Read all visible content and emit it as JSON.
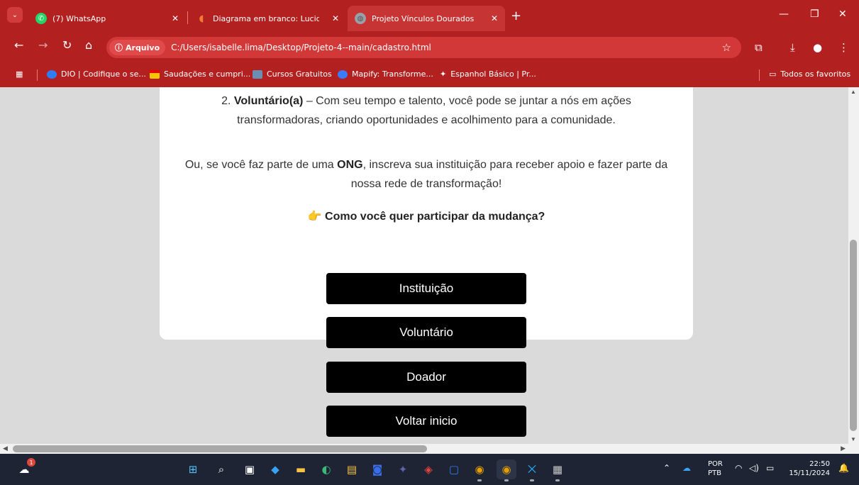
{
  "browser": {
    "tabs": [
      {
        "title": "(7) WhatsApp",
        "icon": "whatsapp-icon",
        "color": "#25d366"
      },
      {
        "title": "Diagrama em branco: Lucidchar",
        "icon": "lucidchart-icon",
        "color": "#f27b35"
      },
      {
        "title": "Projeto Vínculos Dourados",
        "icon": "globe-icon",
        "color": "#9aa0a6",
        "active": true
      }
    ],
    "address": {
      "scheme_label": "Arquivo",
      "url": "C:/Users/isabelle.lima/Desktop/Projeto-4--main/cadastro.html"
    },
    "bookmarks": [
      {
        "label": "DIO | Codifique o se...",
        "icon": "dio-icon",
        "color": "#2f7df6"
      },
      {
        "label": "Saudações e cumpri...",
        "icon": "flag-icon",
        "color": "#f6c700"
      },
      {
        "label": "Cursos Gratuitos",
        "icon": "courses-icon",
        "color": "#6b8fb3"
      },
      {
        "label": "Mapify: Transforme...",
        "icon": "mapify-icon",
        "color": "#3a7bff"
      },
      {
        "label": "Espanhol Básico | Pr...",
        "icon": "spanish-icon",
        "color": "#ffffff"
      }
    ],
    "all_bookmarks_label": "Todos os favoritos"
  },
  "page": {
    "para1": {
      "prefix": "2. ",
      "bold": "Voluntário(a)",
      "line1_rest": " – Com seu tempo e talento, você pode se juntar a nós em ações",
      "line2": "transformadoras, criando oportunidades e acolhimento para a comunidade."
    },
    "para2": {
      "before": "Ou, se você faz parte de uma ",
      "bold": "ONG",
      "line1_rest": ", inscreva sua instituição para receber apoio e fazer parte da",
      "line2": "nossa rede de transformação!"
    },
    "cta": {
      "emoji": "👉",
      "text": "Como você quer participar da mudança?"
    },
    "buttons": [
      "Instituição",
      "Voluntário",
      "Doador",
      "Voltar inicio"
    ]
  },
  "taskbar": {
    "lang_line1": "POR",
    "lang_line2": "PTB",
    "time": "22:50",
    "date": "15/11/2024",
    "notification_badge": "1"
  }
}
